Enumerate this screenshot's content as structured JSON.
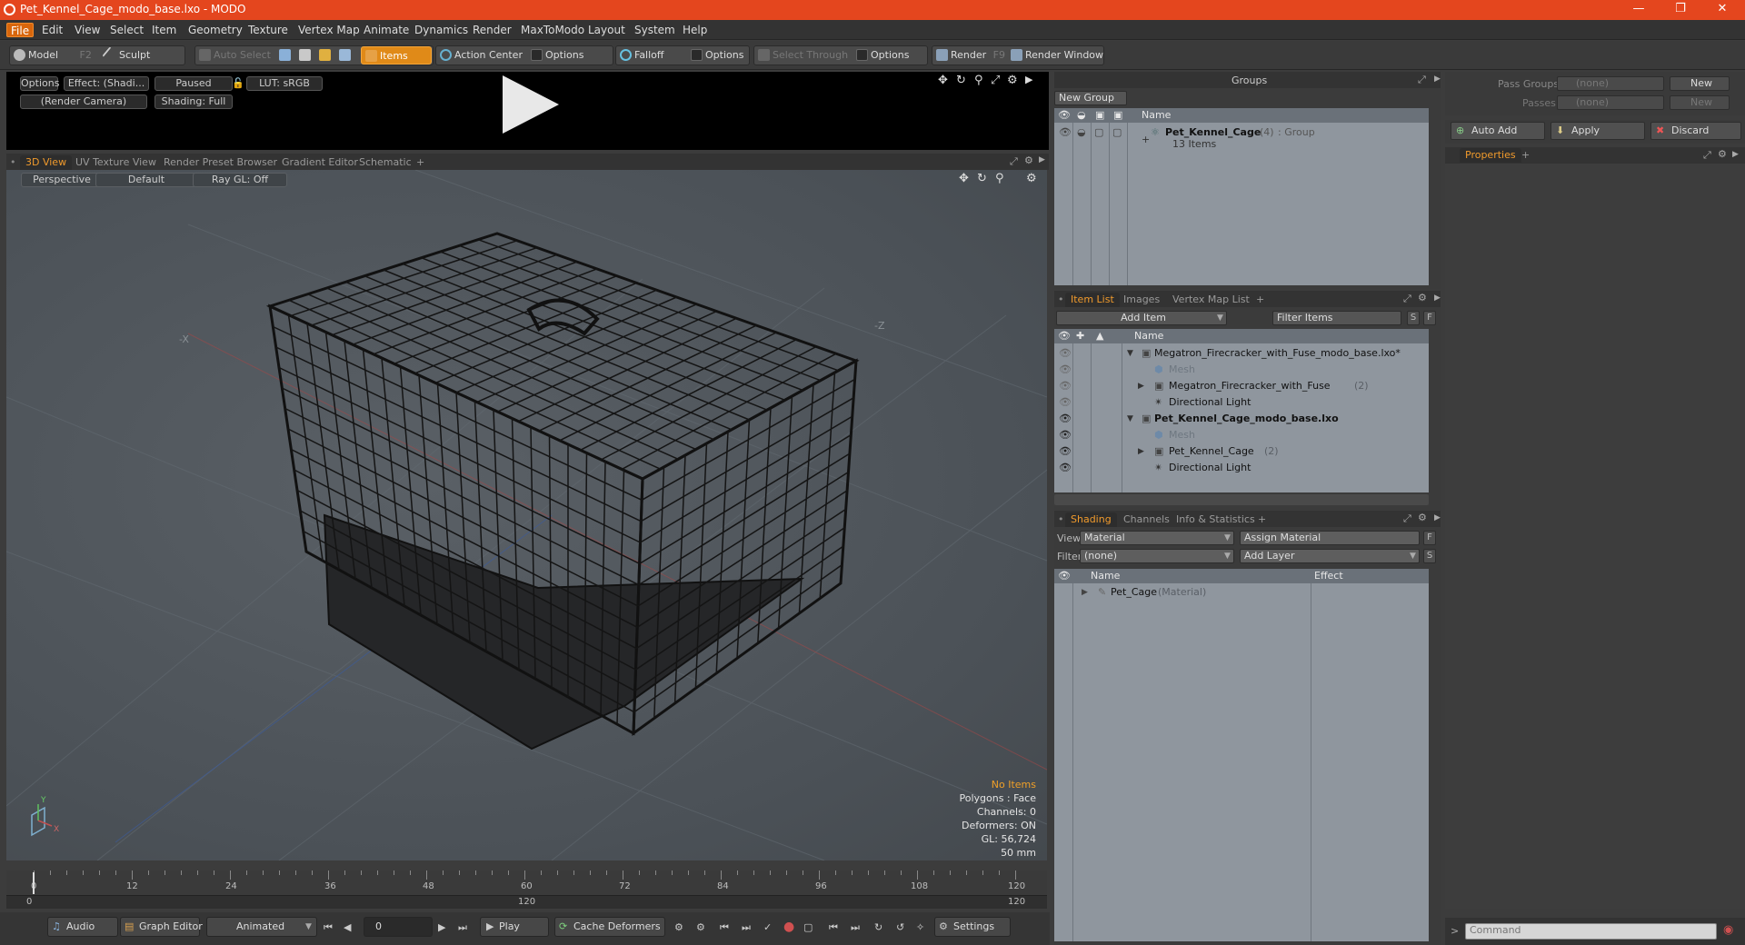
{
  "window": {
    "title": "Pet_Kennel_Cage_modo_base.lxo - MODO"
  },
  "menubar": {
    "items": [
      "File",
      "Edit",
      "View",
      "Select",
      "Item",
      "Geometry",
      "Texture",
      "Vertex Map",
      "Animate",
      "Dynamics",
      "Render",
      "MaxToModo",
      "Layout",
      "System",
      "Help"
    ]
  },
  "toolbar": {
    "model": "Model",
    "model_key": "F2",
    "sculpt": "Sculpt",
    "auto_select": "Auto Select",
    "items": "Items",
    "action_center": "Action Center",
    "options1": "Options",
    "falloff": "Falloff",
    "options2": "Options",
    "select_through": "Select Through",
    "options3": "Options",
    "render": "Render",
    "render_key": "F9",
    "render_window": "Render Window"
  },
  "preview": {
    "options": "Options",
    "effect": "Effect: (Shadi...",
    "paused": "Paused",
    "lut": "LUT: sRGB",
    "camera": "(Render Camera)",
    "shading": "Shading: Full"
  },
  "view_tabs": [
    "3D View",
    "UV Texture View",
    "Render Preset Browser",
    "Gradient Editor",
    "Schematic",
    "+"
  ],
  "viewport": {
    "projection": "Perspective",
    "style": "Default",
    "raygl": "Ray GL: Off",
    "info": {
      "selection": "No Items",
      "polygons": "Polygons : Face",
      "channels": "Channels: 0",
      "deformers": "Deformers: ON",
      "gl": "GL: 56,724",
      "focal": "50 mm"
    },
    "accent": "#f0a028"
  },
  "timeline": {
    "ticks": [
      "0",
      "12",
      "24",
      "36",
      "48",
      "60",
      "72",
      "84",
      "96",
      "108",
      "120"
    ],
    "sub_ticks": [
      "0",
      "120",
      "120"
    ]
  },
  "bottombar": {
    "audio": "Audio",
    "graph_editor": "Graph Editor",
    "animated": "Animated",
    "frame": "0",
    "play": "Play",
    "cache_deformers": "Cache Deformers",
    "settings": "Settings"
  },
  "groups": {
    "title": "Groups",
    "new_group": "New Group",
    "col_name": "Name",
    "row_name": "Pet_Kennel_Cage",
    "row_count": "(4)",
    "row_type": ": Group",
    "row_items": "13 Items"
  },
  "pass_groups": {
    "pass_groups_label": "Pass Groups",
    "pass_groups_value": "(none)",
    "passes_label": "Passes",
    "passes_value": "(none)",
    "new1": "New",
    "new2": "New"
  },
  "actions": {
    "auto_add": "Auto Add",
    "apply": "Apply",
    "discard": "Discard"
  },
  "properties": {
    "tab": "Properties",
    "plus": "+"
  },
  "item_list": {
    "tabs": [
      "Item List",
      "Images",
      "Vertex Map List",
      "+"
    ],
    "add_item": "Add Item",
    "filter": "Filter Items",
    "s": "S",
    "f": "F",
    "col_name": "Name",
    "rows": [
      {
        "label": "Megatron_Firecracker_with_Fuse_modo_base.lxo*",
        "suffix": "",
        "indent": 0,
        "kind": "scene"
      },
      {
        "label": "Mesh",
        "suffix": "",
        "indent": 1,
        "kind": "mesh"
      },
      {
        "label": "Megatron_Firecracker_with_Fuse",
        "suffix": "(2)",
        "indent": 1,
        "kind": "group"
      },
      {
        "label": "Directional Light",
        "suffix": "",
        "indent": 1,
        "kind": "light"
      },
      {
        "label": "Pet_Kennel_Cage_modo_base.lxo",
        "suffix": "",
        "indent": 0,
        "kind": "scene"
      },
      {
        "label": "Mesh",
        "suffix": "",
        "indent": 1,
        "kind": "mesh"
      },
      {
        "label": "Pet_Kennel_Cage",
        "suffix": "(2)",
        "indent": 1,
        "kind": "group"
      },
      {
        "label": "Directional Light",
        "suffix": "",
        "indent": 1,
        "kind": "light"
      }
    ]
  },
  "shading": {
    "tabs": [
      "Shading",
      "Channels",
      "Info & Statistics",
      "+"
    ],
    "view_label": "View",
    "view_value": "Material",
    "assign": "Assign Material",
    "f": "F",
    "filter_label": "Filter",
    "filter_value": "(none)",
    "add_layer": "Add Layer",
    "s": "S",
    "col_name": "Name",
    "col_effect": "Effect",
    "row_name": "Pet_Cage",
    "row_type": "(Material)"
  },
  "command": {
    "placeholder": "Command"
  }
}
